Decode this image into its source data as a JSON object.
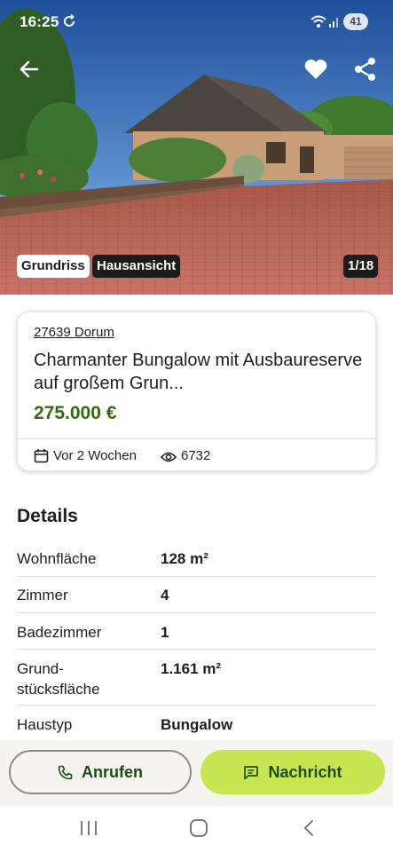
{
  "status_bar": {
    "time": "16:25",
    "battery": "41",
    "icons": [
      "sync-icon",
      "wifi-icon",
      "signal-icon"
    ]
  },
  "gallery": {
    "chip_floorplan": "Grundriss",
    "chip_house_view": "Hausansicht",
    "counter": "1/18",
    "actions": [
      "back-arrow-icon",
      "heart-icon",
      "share-icon"
    ]
  },
  "listing": {
    "location": "27639 Dorum",
    "title": "Charmanter Bungalow mit Ausbaureserve auf großem Grun...",
    "price": "275.000 €",
    "posted": "Vor 2 Wochen",
    "views": "6732"
  },
  "details": {
    "heading": "Details",
    "rows": [
      {
        "label": "Wohnfläche",
        "value": "128 m²"
      },
      {
        "label": "Zimmer",
        "value": "4"
      },
      {
        "label": "Badezimmer",
        "value": "1"
      },
      {
        "label": "Grund-\nstücksfläche",
        "value": "1.161 m²"
      },
      {
        "label": "Haustyp",
        "value": "Bungalow"
      }
    ]
  },
  "actions": {
    "call_label": "Anrufen",
    "message_label": "Nachricht"
  },
  "colors": {
    "price_green": "#326c0e",
    "message_button": "#c7e651",
    "button_text": "#1d4d14"
  }
}
